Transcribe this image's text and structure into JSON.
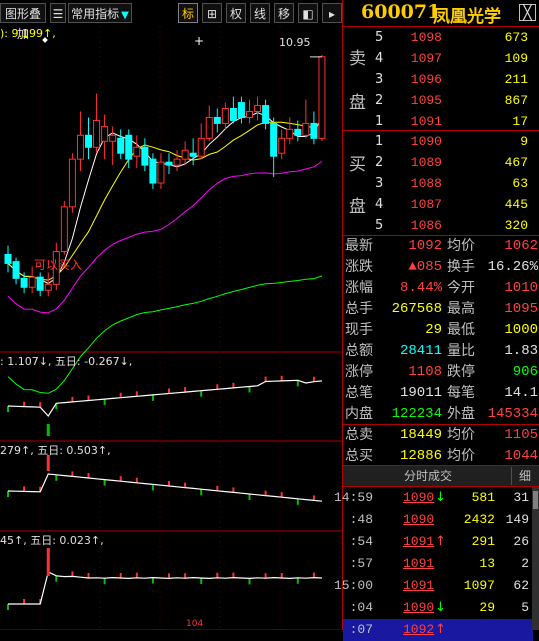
{
  "toolbar": {
    "overlay_label": "图形叠加",
    "indicator_label": "常用指标",
    "dropdown_arrow": "▼",
    "buttons": [
      "标",
      "⊞",
      "权",
      "线",
      "移",
      "◧",
      "▸"
    ]
  },
  "chart": {
    "main_label": "): 9.199↑,",
    "high_price_label": "10.95",
    "annotation": "可以买入",
    "macd_label": ": 1.107↓, 五日: -0.267↓,",
    "ind2_label": "279↑, 五日: 0.503↑,",
    "ind3_label": "45↑, 五日: 0.023↑,",
    "bottom_date": "104",
    "colors": {
      "up": "#ff3030",
      "down": "#00ffff",
      "ma1": "#ffffff",
      "ma2": "#ffff00",
      "ma3": "#ff00ff",
      "ma4": "#00ff00",
      "grid": "#b00000",
      "vol_down": "#00c000"
    }
  },
  "chart_data": {
    "type": "candlestick",
    "candles": [
      {
        "o": 7.6,
        "c": 7.45,
        "h": 7.75,
        "l": 7.3
      },
      {
        "o": 7.48,
        "c": 7.2,
        "h": 7.55,
        "l": 7.1
      },
      {
        "o": 7.2,
        "c": 7.05,
        "h": 7.3,
        "l": 6.95
      },
      {
        "o": 7.05,
        "c": 7.22,
        "h": 7.4,
        "l": 6.95
      },
      {
        "o": 7.22,
        "c": 7.0,
        "h": 7.3,
        "l": 6.9
      },
      {
        "o": 7.0,
        "c": 7.1,
        "h": 7.3,
        "l": 6.9
      },
      {
        "o": 7.1,
        "c": 7.65,
        "h": 7.8,
        "l": 7.0
      },
      {
        "o": 7.65,
        "c": 8.4,
        "h": 8.5,
        "l": 7.6
      },
      {
        "o": 8.4,
        "c": 9.2,
        "h": 9.3,
        "l": 8.3
      },
      {
        "o": 9.2,
        "c": 9.6,
        "h": 10.0,
        "l": 9.0
      },
      {
        "o": 9.6,
        "c": 9.4,
        "h": 9.9,
        "l": 9.2
      },
      {
        "o": 9.4,
        "c": 9.85,
        "h": 10.3,
        "l": 9.3
      },
      {
        "o": 9.5,
        "c": 9.75,
        "h": 9.95,
        "l": 9.2
      },
      {
        "o": 9.5,
        "c": 9.6,
        "h": 9.75,
        "l": 9.1
      },
      {
        "o": 9.55,
        "c": 9.3,
        "h": 9.7,
        "l": 9.2
      },
      {
        "o": 9.6,
        "c": 9.2,
        "h": 9.7,
        "l": 9.05
      },
      {
        "o": 9.25,
        "c": 9.4,
        "h": 9.6,
        "l": 9.05
      },
      {
        "o": 9.4,
        "c": 9.1,
        "h": 9.55,
        "l": 9.0
      },
      {
        "o": 9.2,
        "c": 8.8,
        "h": 9.3,
        "l": 8.7
      },
      {
        "o": 8.8,
        "c": 9.15,
        "h": 9.3,
        "l": 8.7
      },
      {
        "o": 9.15,
        "c": 9.1,
        "h": 9.3,
        "l": 8.95
      },
      {
        "o": 9.1,
        "c": 9.2,
        "h": 9.35,
        "l": 9.0
      },
      {
        "o": 9.2,
        "c": 9.35,
        "h": 9.5,
        "l": 9.1
      },
      {
        "o": 9.3,
        "c": 9.25,
        "h": 9.55,
        "l": 9.1
      },
      {
        "o": 9.25,
        "c": 9.55,
        "h": 9.8,
        "l": 9.2
      },
      {
        "o": 9.55,
        "c": 9.9,
        "h": 10.1,
        "l": 9.5
      },
      {
        "o": 9.9,
        "c": 9.8,
        "h": 10.05,
        "l": 9.65
      },
      {
        "o": 9.8,
        "c": 10.05,
        "h": 10.15,
        "l": 9.7
      },
      {
        "o": 10.05,
        "c": 9.85,
        "h": 10.25,
        "l": 9.8
      },
      {
        "o": 10.15,
        "c": 9.9,
        "h": 10.25,
        "l": 9.8
      },
      {
        "o": 9.9,
        "c": 10.0,
        "h": 10.2,
        "l": 9.8
      },
      {
        "o": 10.0,
        "c": 10.1,
        "h": 10.25,
        "l": 9.85
      },
      {
        "o": 10.1,
        "c": 9.8,
        "h": 10.2,
        "l": 9.7
      },
      {
        "o": 9.8,
        "c": 9.25,
        "h": 9.9,
        "l": 8.9
      },
      {
        "o": 9.3,
        "c": 9.55,
        "h": 9.7,
        "l": 9.2
      },
      {
        "o": 9.55,
        "c": 9.7,
        "h": 9.9,
        "l": 9.45
      },
      {
        "o": 9.7,
        "c": 9.6,
        "h": 9.85,
        "l": 9.5
      },
      {
        "o": 9.6,
        "c": 9.8,
        "h": 10.2,
        "l": 9.55
      },
      {
        "o": 9.8,
        "c": 9.55,
        "h": 10.0,
        "l": 9.45
      },
      {
        "o": 9.55,
        "c": 10.92,
        "h": 10.95,
        "l": 9.5
      }
    ],
    "annotated_high": 10.95
  },
  "orderbook": {
    "sell_label": [
      "卖",
      "盘"
    ],
    "buy_label": [
      "买",
      "盘"
    ],
    "sell": [
      {
        "lvl": "5",
        "price": "1098",
        "vol": "673"
      },
      {
        "lvl": "4",
        "price": "1097",
        "vol": "109"
      },
      {
        "lvl": "3",
        "price": "1096",
        "vol": "211"
      },
      {
        "lvl": "2",
        "price": "1095",
        "vol": "867"
      },
      {
        "lvl": "1",
        "price": "1091",
        "vol": "17"
      }
    ],
    "buy": [
      {
        "lvl": "1",
        "price": "1090",
        "vol": "9"
      },
      {
        "lvl": "2",
        "price": "1089",
        "vol": "467"
      },
      {
        "lvl": "3",
        "price": "1088",
        "vol": "63"
      },
      {
        "lvl": "4",
        "price": "1087",
        "vol": "445"
      },
      {
        "lvl": "5",
        "price": "1086",
        "vol": "320"
      }
    ]
  },
  "stock": {
    "code": "600071",
    "name": "凤凰光学",
    "close_icon": "╳"
  },
  "stats": [
    {
      "k1": "最新",
      "v1": "1092",
      "c1": "#ff4040",
      "k2": "均价",
      "v2": "1062",
      "c2": "#ff4040"
    },
    {
      "k1": "涨跌",
      "v1": "▲085",
      "c1": "#ff4040",
      "k2": "换手",
      "v2": "16.26%",
      "c2": "#e0e0e0"
    },
    {
      "k1": "涨幅",
      "v1": "8.44%",
      "c1": "#ff4040",
      "k2": "今开",
      "v2": "1010",
      "c2": "#ff4040"
    },
    {
      "k1": "总手",
      "v1": "267568",
      "c1": "#ffff00",
      "k2": "最高",
      "v2": "1095",
      "c2": "#ff4040"
    },
    {
      "k1": "现手",
      "v1": "29",
      "c1": "#ffff00",
      "k2": "最低",
      "v2": "1000",
      "c2": "#ffff00"
    },
    {
      "k1": "总额",
      "v1": "28411",
      "c1": "#00ffff",
      "k2": "量比",
      "v2": "1.83",
      "c2": "#e0e0e0"
    },
    {
      "k1": "涨停",
      "v1": "1108",
      "c1": "#ff4040",
      "k2": "跌停",
      "v2": "906",
      "c2": "#00ff00"
    },
    {
      "k1": "总笔",
      "v1": "19011",
      "c1": "#e0e0e0",
      "k2": "每笔",
      "v2": "14.1",
      "c2": "#e0e0e0"
    },
    {
      "k1": "内盘",
      "v1": "122234",
      "c1": "#00ff00",
      "k2": "外盘",
      "v2": "145334",
      "c2": "#ff4040"
    }
  ],
  "totals": [
    {
      "k1": "总卖",
      "v1": "18449",
      "c1": "#ffff00",
      "k2": "均价",
      "v2": "1105",
      "c2": "#ff4040"
    },
    {
      "k1": "总买",
      "v1": "12886",
      "c1": "#ffff00",
      "k2": "均价",
      "v2": "1044",
      "c2": "#ff4040"
    }
  ],
  "ticks": {
    "title": "分时成交",
    "detail_label": "细",
    "rows": [
      {
        "t": "14:59",
        "p": "1090",
        "arrow": "↓",
        "ac": "#00ff00",
        "v": "581",
        "n": "31"
      },
      {
        "t": ":48",
        "p": "1090",
        "arrow": "",
        "ac": "#00ff00",
        "v": "2432",
        "n": "149"
      },
      {
        "t": ":54",
        "p": "1091",
        "arrow": "↑",
        "ac": "#ff4040",
        "v": "291",
        "n": "26"
      },
      {
        "t": ":57",
        "p": "1091",
        "arrow": "",
        "ac": "#ff4040",
        "v": "13",
        "n": "2"
      },
      {
        "t": "15:00",
        "p": "1091",
        "arrow": "",
        "ac": "#ff4040",
        "v": "1097",
        "n": "62"
      },
      {
        "t": ":04",
        "p": "1090",
        "arrow": "↓",
        "ac": "#00ff00",
        "v": "29",
        "n": "5"
      },
      {
        "t": ":07",
        "p": "1092",
        "arrow": "↑",
        "ac": "#ff4040",
        "v": "",
        "n": ""
      }
    ]
  }
}
